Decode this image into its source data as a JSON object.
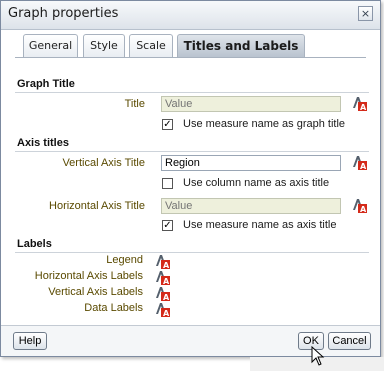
{
  "dialog": {
    "title": "Graph properties",
    "close_label": "×"
  },
  "tabs": [
    {
      "label": "General"
    },
    {
      "label": "Style"
    },
    {
      "label": "Scale"
    },
    {
      "label": "Titles and Labels",
      "active": true
    }
  ],
  "sections": {
    "graph_title": {
      "heading": "Graph Title",
      "title_label": "Title",
      "title_placeholder": "Value",
      "use_measure_label": "Use measure name as graph title",
      "use_measure_checked": true
    },
    "axis_titles": {
      "heading": "Axis titles",
      "vertical_label": "Vertical Axis Title",
      "vertical_value": "Region",
      "use_column_label": "Use column name as axis title",
      "use_column_checked": false,
      "horizontal_label": "Horizontal Axis Title",
      "horizontal_placeholder": "Value",
      "use_measure_label": "Use measure name as axis title",
      "use_measure_checked": true
    },
    "labels": {
      "heading": "Labels",
      "items": [
        "Legend",
        "Horizontal Axis Labels",
        "Vertical Axis Labels",
        "Data Labels"
      ]
    }
  },
  "footer": {
    "help_label": "Help",
    "ok_label": "OK",
    "cancel_label": "Cancel"
  },
  "colors": {
    "label_text": "#5a4a00",
    "active_tab": "#c3ccd7",
    "format_icon_red": "#d42a1a"
  }
}
